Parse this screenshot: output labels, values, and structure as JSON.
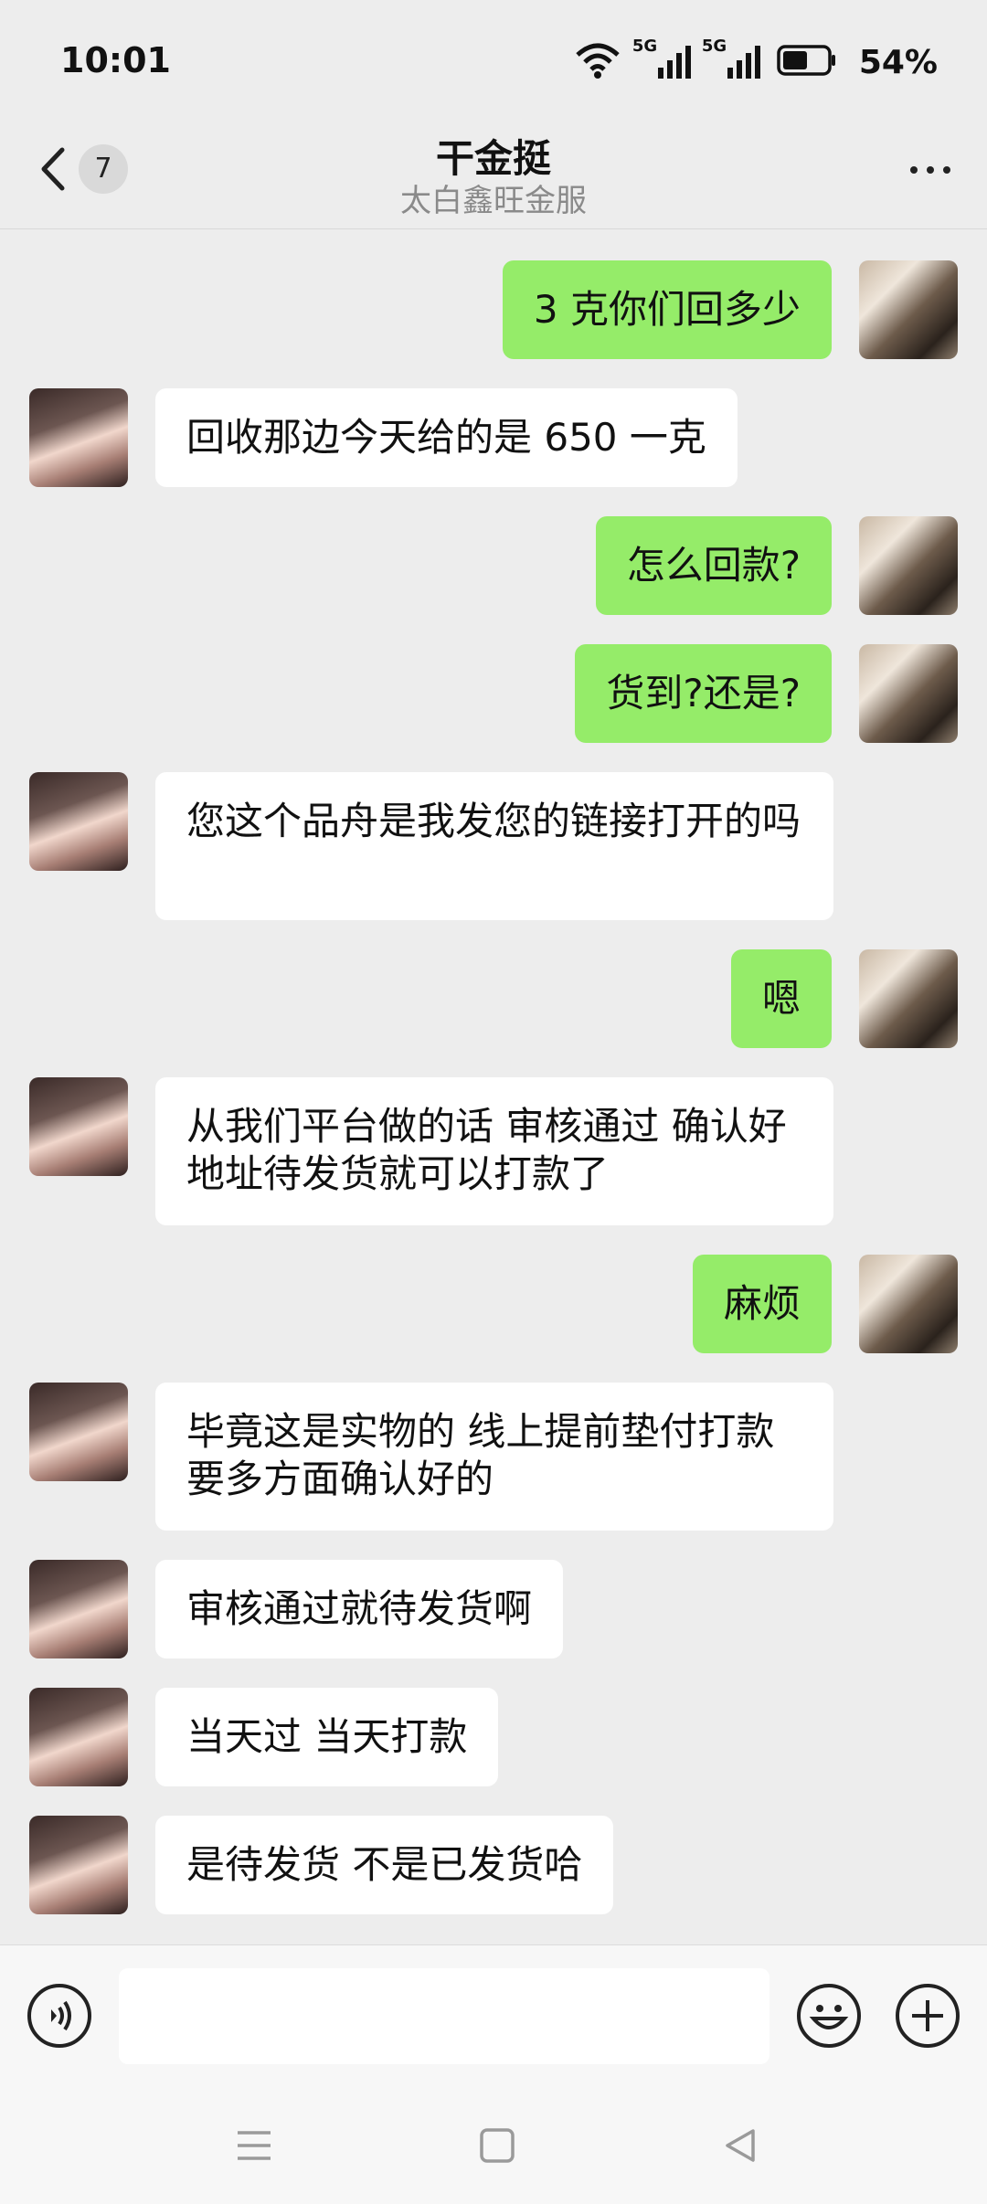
{
  "status_bar": {
    "time": "10:01",
    "battery_percent": "54%",
    "signal_labels": [
      "5G",
      "5G"
    ]
  },
  "header": {
    "unread_count": "7",
    "title": "干金挺",
    "subtitle": "太白鑫旺金服"
  },
  "messages": [
    {
      "side": "out",
      "text": "3 克你们回多少"
    },
    {
      "side": "in",
      "text": "回收那边今天给的是 650 一克"
    },
    {
      "side": "out",
      "text": "怎么回款?"
    },
    {
      "side": "out",
      "text": "货到?还是?"
    },
    {
      "side": "in",
      "text": "您这个品舟是我发您的链接打开的吗"
    },
    {
      "side": "out",
      "text": "嗯"
    },
    {
      "side": "in",
      "text": "从我们平台做的话 审核通过 确认好地址待发货就可以打款了"
    },
    {
      "side": "out",
      "text": "麻烦"
    },
    {
      "side": "in",
      "text": "毕竟这是实物的 线上提前垫付打款 要多方面确认好的"
    },
    {
      "side": "in",
      "text": "审核通过就待发货啊"
    },
    {
      "side": "in",
      "text": "当天过 当天打款"
    },
    {
      "side": "in",
      "text": "是待发货 不是已发货哈"
    }
  ],
  "input": {
    "value": ""
  },
  "colors": {
    "outgoing_bubble": "#95ec69",
    "incoming_bubble": "#ffffff",
    "background": "#ededed"
  }
}
